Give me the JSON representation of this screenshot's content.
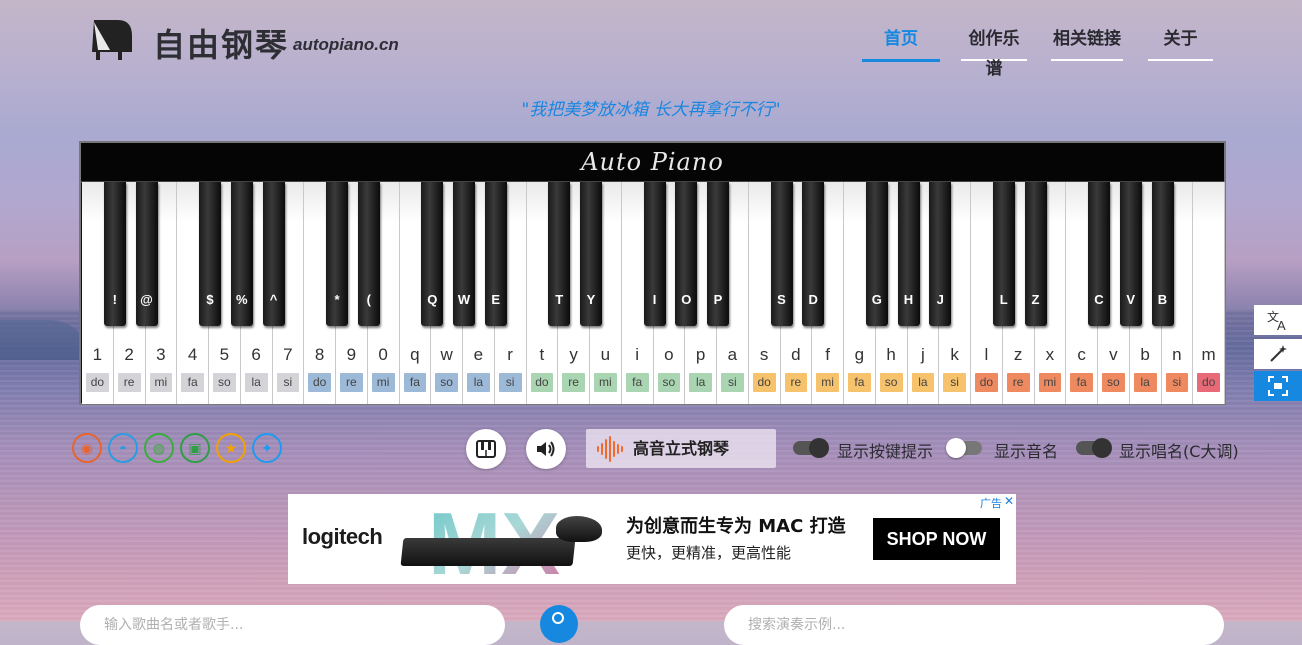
{
  "header": {
    "site_title": "自由钢琴",
    "site_domain": "autopiano.cn",
    "nav": [
      {
        "label": "首页",
        "active": true
      },
      {
        "label": "创作乐谱",
        "active": false
      },
      {
        "label": "相关链接",
        "active": false
      },
      {
        "label": "关于",
        "active": false
      }
    ]
  },
  "slogan": "\"我把美梦放冰箱 长大再拿行不行\"",
  "piano": {
    "brand": "Auto Piano",
    "white_keys": [
      {
        "key": "1",
        "solfege": "do",
        "color": "#d4d4d8"
      },
      {
        "key": "2",
        "solfege": "re",
        "color": "#d4d4d8"
      },
      {
        "key": "3",
        "solfege": "mi",
        "color": "#d4d4d8"
      },
      {
        "key": "4",
        "solfege": "fa",
        "color": "#d4d4d8"
      },
      {
        "key": "5",
        "solfege": "so",
        "color": "#d4d4d8"
      },
      {
        "key": "6",
        "solfege": "la",
        "color": "#d4d4d8"
      },
      {
        "key": "7",
        "solfege": "si",
        "color": "#d4d4d8"
      },
      {
        "key": "8",
        "solfege": "do",
        "color": "#9db9d8"
      },
      {
        "key": "9",
        "solfege": "re",
        "color": "#9db9d8"
      },
      {
        "key": "0",
        "solfege": "mi",
        "color": "#9db9d8"
      },
      {
        "key": "q",
        "solfege": "fa",
        "color": "#9db9d8"
      },
      {
        "key": "w",
        "solfege": "so",
        "color": "#9db9d8"
      },
      {
        "key": "e",
        "solfege": "la",
        "color": "#9db9d8"
      },
      {
        "key": "r",
        "solfege": "si",
        "color": "#9db9d8"
      },
      {
        "key": "t",
        "solfege": "do",
        "color": "#a9d5b2"
      },
      {
        "key": "y",
        "solfege": "re",
        "color": "#a9d5b2"
      },
      {
        "key": "u",
        "solfege": "mi",
        "color": "#a9d5b2"
      },
      {
        "key": "i",
        "solfege": "fa",
        "color": "#a9d5b2"
      },
      {
        "key": "o",
        "solfege": "so",
        "color": "#a9d5b2"
      },
      {
        "key": "p",
        "solfege": "la",
        "color": "#a9d5b2"
      },
      {
        "key": "a",
        "solfege": "si",
        "color": "#a9d5b2"
      },
      {
        "key": "s",
        "solfege": "do",
        "color": "#f6c26c"
      },
      {
        "key": "d",
        "solfege": "re",
        "color": "#f6c26c"
      },
      {
        "key": "f",
        "solfege": "mi",
        "color": "#f6c26c"
      },
      {
        "key": "g",
        "solfege": "fa",
        "color": "#f6c26c"
      },
      {
        "key": "h",
        "solfege": "so",
        "color": "#f6c26c"
      },
      {
        "key": "j",
        "solfege": "la",
        "color": "#f6c26c"
      },
      {
        "key": "k",
        "solfege": "si",
        "color": "#f6c26c"
      },
      {
        "key": "l",
        "solfege": "do",
        "color": "#ef8a60"
      },
      {
        "key": "z",
        "solfege": "re",
        "color": "#ef8a60"
      },
      {
        "key": "x",
        "solfege": "mi",
        "color": "#ef8a60"
      },
      {
        "key": "c",
        "solfege": "fa",
        "color": "#ef8a60"
      },
      {
        "key": "v",
        "solfege": "so",
        "color": "#ef8a60"
      },
      {
        "key": "b",
        "solfege": "la",
        "color": "#ef8a60"
      },
      {
        "key": "n",
        "solfege": "si",
        "color": "#ef8a60"
      },
      {
        "key": "m",
        "solfege": "do",
        "color": "#e86a78"
      }
    ],
    "black_keys": [
      {
        "key": "!",
        "after": 0
      },
      {
        "key": "@",
        "after": 1
      },
      {
        "key": "$",
        "after": 3
      },
      {
        "key": "%",
        "after": 4
      },
      {
        "key": "^",
        "after": 5
      },
      {
        "key": "*",
        "after": 7
      },
      {
        "key": "(",
        "after": 8
      },
      {
        "key": "Q",
        "after": 10
      },
      {
        "key": "W",
        "after": 11
      },
      {
        "key": "E",
        "after": 12
      },
      {
        "key": "T",
        "after": 14
      },
      {
        "key": "Y",
        "after": 15
      },
      {
        "key": "I",
        "after": 17
      },
      {
        "key": "O",
        "after": 18
      },
      {
        "key": "P",
        "after": 19
      },
      {
        "key": "S",
        "after": 21
      },
      {
        "key": "D",
        "after": 22
      },
      {
        "key": "G",
        "after": 24
      },
      {
        "key": "H",
        "after": 25
      },
      {
        "key": "J",
        "after": 26
      },
      {
        "key": "L",
        "after": 28
      },
      {
        "key": "Z",
        "after": 29
      },
      {
        "key": "C",
        "after": 31
      },
      {
        "key": "V",
        "after": 32
      },
      {
        "key": "B",
        "after": 33
      }
    ]
  },
  "controls": {
    "sound_name": "高音立式钢琴",
    "toggles": [
      {
        "label": "显示按键提示",
        "on": true
      },
      {
        "label": "显示音名",
        "on": false
      },
      {
        "label": "显示唱名(C大调)",
        "on": true
      }
    ],
    "social_icons": [
      {
        "name": "weibo-icon",
        "color": "#e8642c"
      },
      {
        "name": "qq-icon",
        "color": "#2a9de0"
      },
      {
        "name": "wechat-icon",
        "color": "#3aae3a"
      },
      {
        "name": "douban-icon",
        "color": "#2f9e44"
      },
      {
        "name": "qzone-icon",
        "color": "#f2a100"
      },
      {
        "name": "twitter-icon",
        "color": "#1d9bf0"
      }
    ]
  },
  "ad": {
    "brand": "logitech",
    "product": "MX",
    "title": "为创意而生专为 MAC 打造",
    "subtitle": "更快，更精准，更高性能",
    "cta": "SHOP NOW",
    "badge": "广告"
  },
  "search": {
    "left_placeholder": "输入歌曲名或者歌手...",
    "right_placeholder": "搜索演奏示例..."
  }
}
